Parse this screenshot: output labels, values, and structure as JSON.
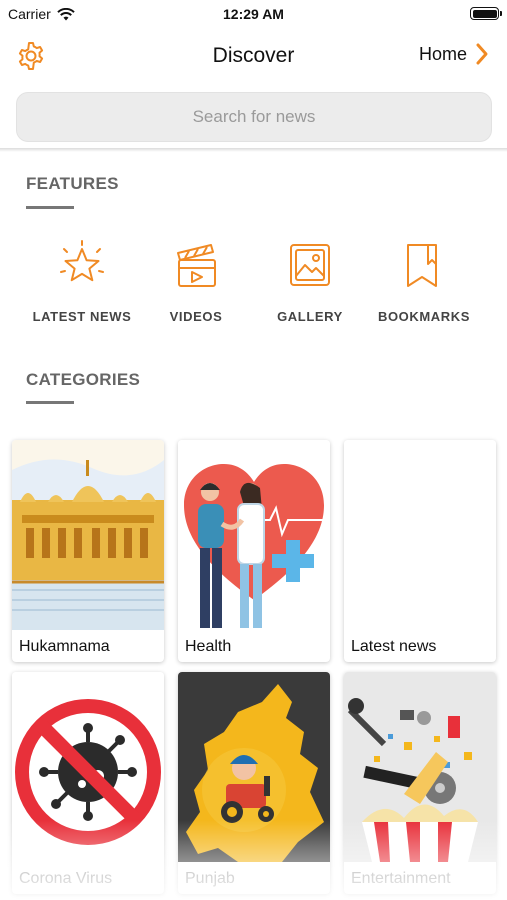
{
  "status_bar": {
    "carrier": "Carrier",
    "time": "12:29 AM"
  },
  "nav": {
    "title": "Discover",
    "home_label": "Home"
  },
  "search": {
    "placeholder": "Search for news"
  },
  "features": {
    "title": "FEATURES",
    "items": [
      {
        "label": "LATEST NEWS",
        "icon": "star-icon"
      },
      {
        "label": "VIDEOS",
        "icon": "clapperboard-icon"
      },
      {
        "label": "GALLERY",
        "icon": "gallery-icon"
      },
      {
        "label": "BOOKMARKS",
        "icon": "bookmark-icon"
      }
    ]
  },
  "categories": {
    "title": "CATEGORIES",
    "items": [
      {
        "label": "Hukamnama"
      },
      {
        "label": "Health"
      },
      {
        "label": "Latest news"
      },
      {
        "label": "Corona Virus"
      },
      {
        "label": "Punjab"
      },
      {
        "label": "Entertainment"
      }
    ]
  },
  "colors": {
    "accent": "#F08A24",
    "text": "#222222",
    "section": "#666666"
  }
}
